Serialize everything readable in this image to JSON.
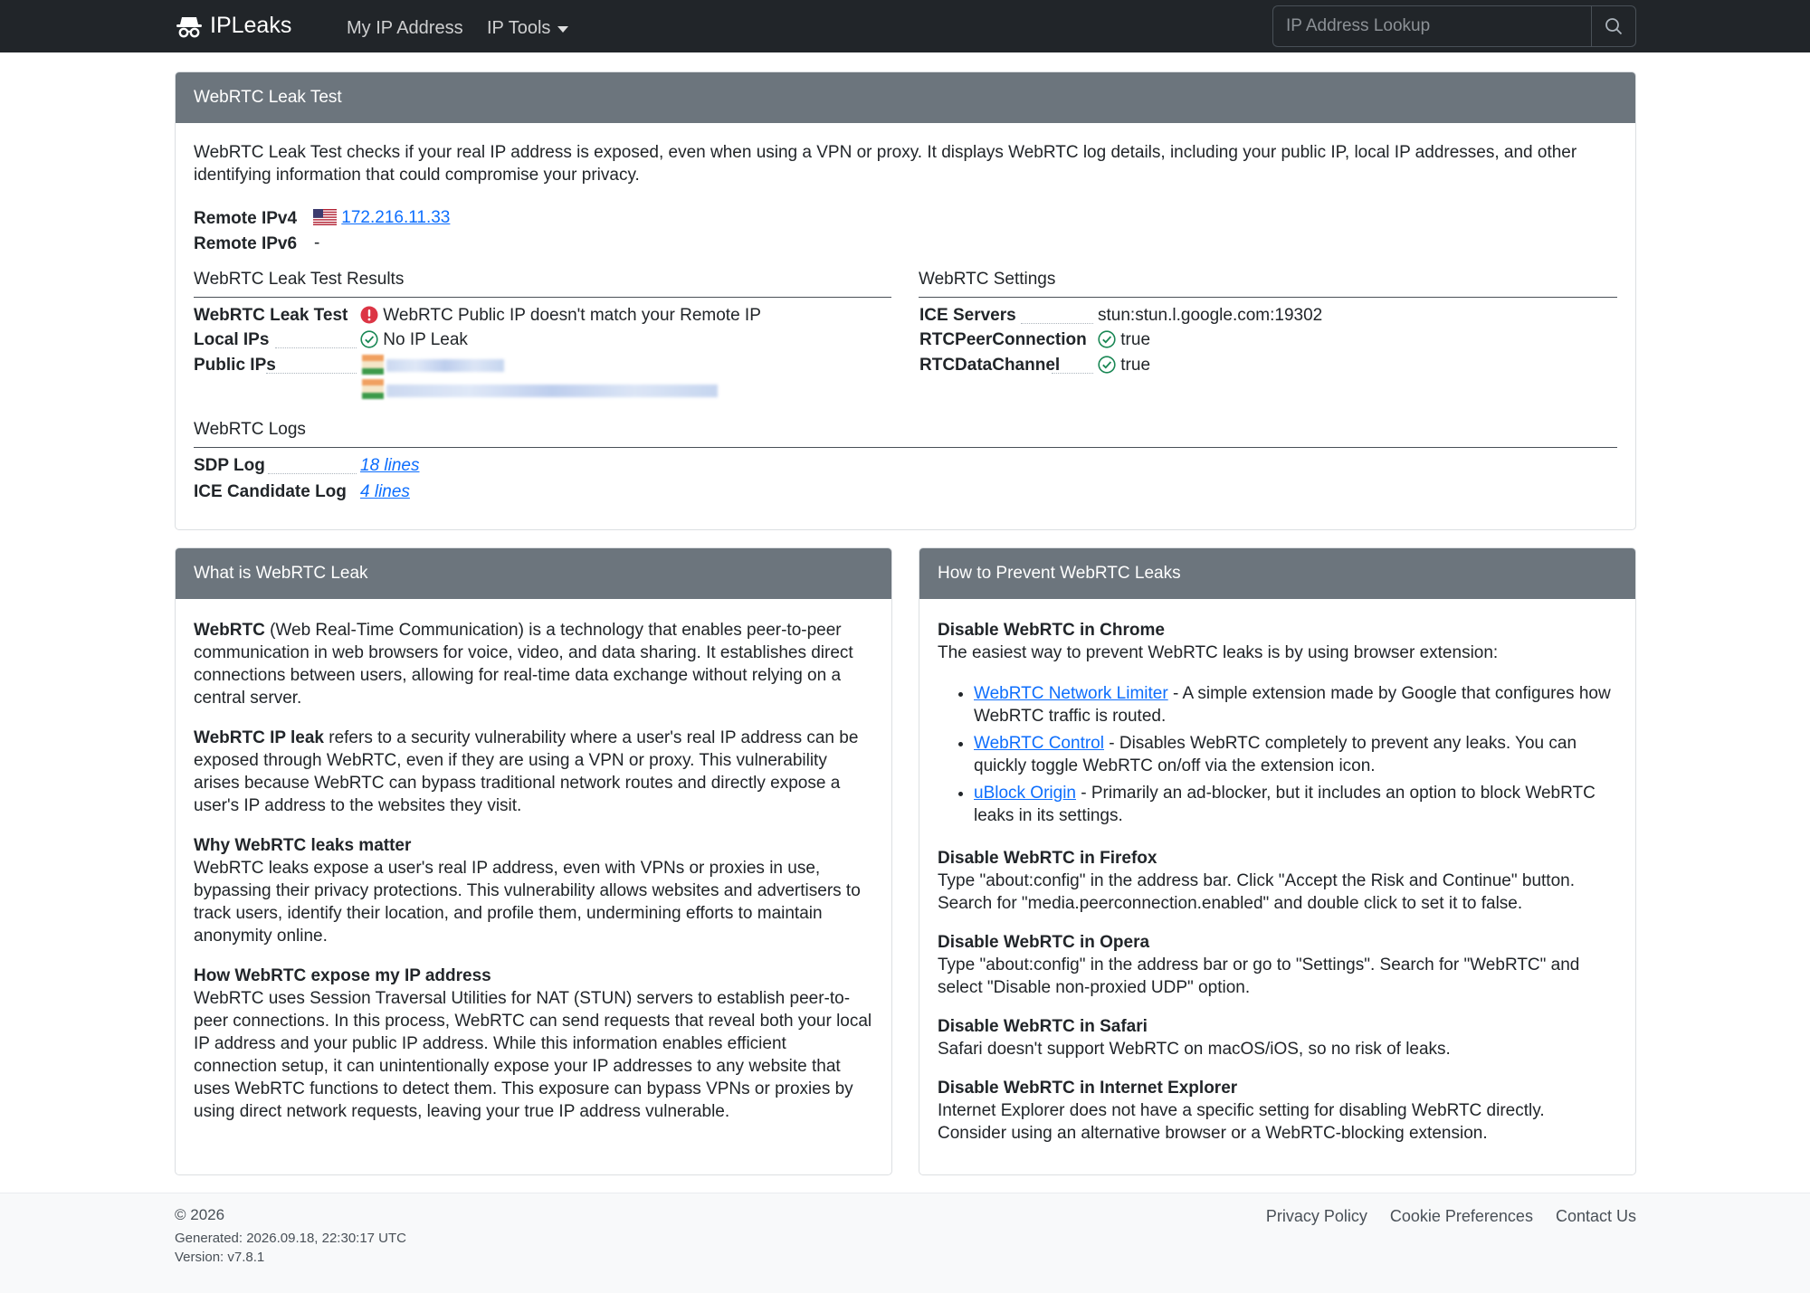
{
  "navbar": {
    "brand": "IPLeaks",
    "links": [
      "My IP Address",
      "IP Tools"
    ],
    "search_placeholder": "IP Address Lookup"
  },
  "leak_card": {
    "header": "WebRTC Leak Test",
    "intro": "WebRTC Leak Test checks if your real IP address is exposed, even when using a VPN or proxy. It displays WebRTC log details, including your public IP, local IP addresses, and other identifying information that could compromise your privacy.",
    "remote_ipv4_label": "Remote IPv4",
    "remote_ipv4_value": "172.216.11.33",
    "remote_ipv6_label": "Remote IPv6",
    "remote_ipv6_value": "-",
    "results": {
      "title": "WebRTC Leak Test Results",
      "leak_test_label": "WebRTC Leak Test",
      "leak_test_value": "WebRTC Public IP doesn't match your Remote IP",
      "local_ips_label": "Local IPs",
      "local_ips_value": "No IP Leak",
      "public_ips_label": "Public IPs"
    },
    "settings": {
      "title": "WebRTC Settings",
      "ice_servers_label": "ICE Servers",
      "ice_servers_value": "stun:stun.l.google.com:19302",
      "rtcpeer_label": "RTCPeerConnection",
      "rtcpeer_value": "true",
      "rtcdata_label": "RTCDataChannel",
      "rtcdata_value": "true"
    },
    "logs": {
      "title": "WebRTC Logs",
      "sdp_label": "SDP Log",
      "sdp_value": "18 lines",
      "ice_label": "ICE Candidate Log",
      "ice_value": "4 lines"
    }
  },
  "what_card": {
    "header": "What is WebRTC Leak",
    "p1_bold": "WebRTC",
    "p1_text": " (Web Real-Time Communication) is a technology that enables peer-to-peer communication in web browsers for voice, video, and data sharing. It establishes direct connections between users, allowing for real-time data exchange without relying on a central server.",
    "p2_bold": "WebRTC IP leak",
    "p2_text": " refers to a security vulnerability where a user's real IP address can be exposed through WebRTC, even if they are using a VPN or proxy. This vulnerability arises because WebRTC can bypass traditional network routes and directly expose a user's IP address to the websites they visit.",
    "h3": "Why WebRTC leaks matter",
    "p3": "WebRTC leaks expose a user's real IP address, even with VPNs or proxies in use, bypassing their privacy protections. This vulnerability allows websites and advertisers to track users, identify their location, and profile them, undermining efforts to maintain anonymity online.",
    "h4": "How WebRTC expose my IP address",
    "p4": "WebRTC uses Session Traversal Utilities for NAT (STUN) servers to establish peer-to-peer connections. In this process, WebRTC can send requests that reveal both your local IP address and your public IP address. While this information enables efficient connection setup, it can unintentionally expose your IP addresses to any website that uses WebRTC functions to detect them. This exposure can bypass VPNs or proxies by using direct network requests, leaving your true IP address vulnerable."
  },
  "how_card": {
    "header": "How to Prevent WebRTC Leaks",
    "chrome_title": "Disable WebRTC in Chrome",
    "chrome_text": "The easiest way to prevent WebRTC leaks is by using browser extension:",
    "extensions": [
      {
        "name": "WebRTC Network Limiter",
        "desc": " - A simple extension made by Google that configures how WebRTC traffic is routed."
      },
      {
        "name": "WebRTC Control",
        "desc": " - Disables WebRTC completely to prevent any leaks. You can quickly toggle WebRTC on/off via the extension icon."
      },
      {
        "name": "uBlock Origin",
        "desc": " - Primarily an ad-blocker, but it includes an option to block WebRTC leaks in its settings."
      }
    ],
    "firefox_title": "Disable WebRTC in Firefox",
    "firefox_text": "Type \"about:config\" in the address bar. Click \"Accept the Risk and Continue\" button. Search for \"media.peerconnection.enabled\" and double click to set it to false.",
    "opera_title": "Disable WebRTC in Opera",
    "opera_text": "Type \"about:config\" in the address bar or go to \"Settings\". Search for \"WebRTC\" and select \"Disable non-proxied UDP\" option.",
    "safari_title": "Disable WebRTC in Safari",
    "safari_text": "Safari doesn't support WebRTC on macOS/iOS, so no risk of leaks.",
    "ie_title": "Disable WebRTC in Internet Explorer",
    "ie_text": "Internet Explorer does not have a specific setting for disabling WebRTC directly. Consider using an alternative browser or a WebRTC-blocking extension."
  },
  "footer": {
    "copyright": "© 2026",
    "generated": "Generated: 2026.09.18, 22:30:17 UTC",
    "version": "Version: v7.8.1",
    "links": [
      "Privacy Policy",
      "Cookie Preferences",
      "Contact Us"
    ]
  },
  "colors": {
    "navbar_bg": "#212529",
    "card_header_bg": "#6c757d",
    "link": "#0d6efd",
    "success": "#198754",
    "danger": "#dc3545"
  }
}
